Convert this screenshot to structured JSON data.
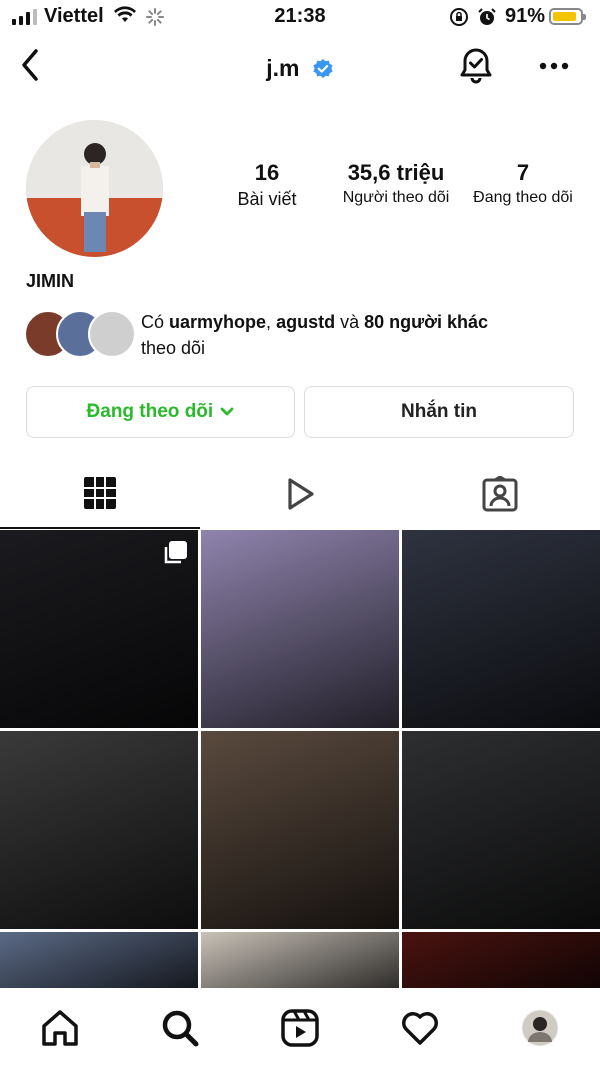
{
  "status_bar": {
    "carrier": "Viettel",
    "time": "21:38",
    "battery_percent": "91%",
    "battery_level": 0.91,
    "battery_color": "#f5c400"
  },
  "header": {
    "username": "j.m",
    "verified": true,
    "icons": [
      "back-chevron-icon",
      "notification-bell-icon",
      "more-options-icon"
    ]
  },
  "profile": {
    "display_name": "JIMIN",
    "stats": [
      {
        "value": "16",
        "label": "Bài viết"
      },
      {
        "value": "35,6 triệu",
        "label": "Người theo dõi"
      },
      {
        "value": "7",
        "label": "Đang theo dõi"
      }
    ],
    "followed_by": {
      "prefix": "Có ",
      "user1": "uarmyhope",
      "sep": ", ",
      "user2": "agustd",
      "mid": " và ",
      "others": "80 người khác",
      "suffix": "theo dõi"
    }
  },
  "actions": {
    "following_label": "Đang theo dõi",
    "message_label": "Nhắn tin",
    "following_color": "#2bba2b"
  },
  "tabs": [
    "grid-posts-icon",
    "reels-play-icon",
    "tagged-posts-icon"
  ],
  "posts": [
    {
      "type": "multi-photo",
      "tone": "#1b1b1f"
    },
    {
      "type": "photo",
      "tone": "#8f84ad"
    },
    {
      "type": "photo",
      "tone": "#2f3340"
    },
    {
      "type": "photo",
      "tone": "#3a3a3a"
    },
    {
      "type": "photo",
      "tone": "#5a4a3e"
    },
    {
      "type": "photo",
      "tone": "#2e2f31"
    },
    {
      "type": "photo",
      "tone": "#5b6a86"
    },
    {
      "type": "photo",
      "tone": "#c9c2b8"
    },
    {
      "type": "photo",
      "tone": "#4a1310"
    }
  ],
  "bottom_nav": [
    "home-icon",
    "search-icon",
    "reels-icon",
    "activity-heart-icon",
    "profile-avatar-icon"
  ]
}
